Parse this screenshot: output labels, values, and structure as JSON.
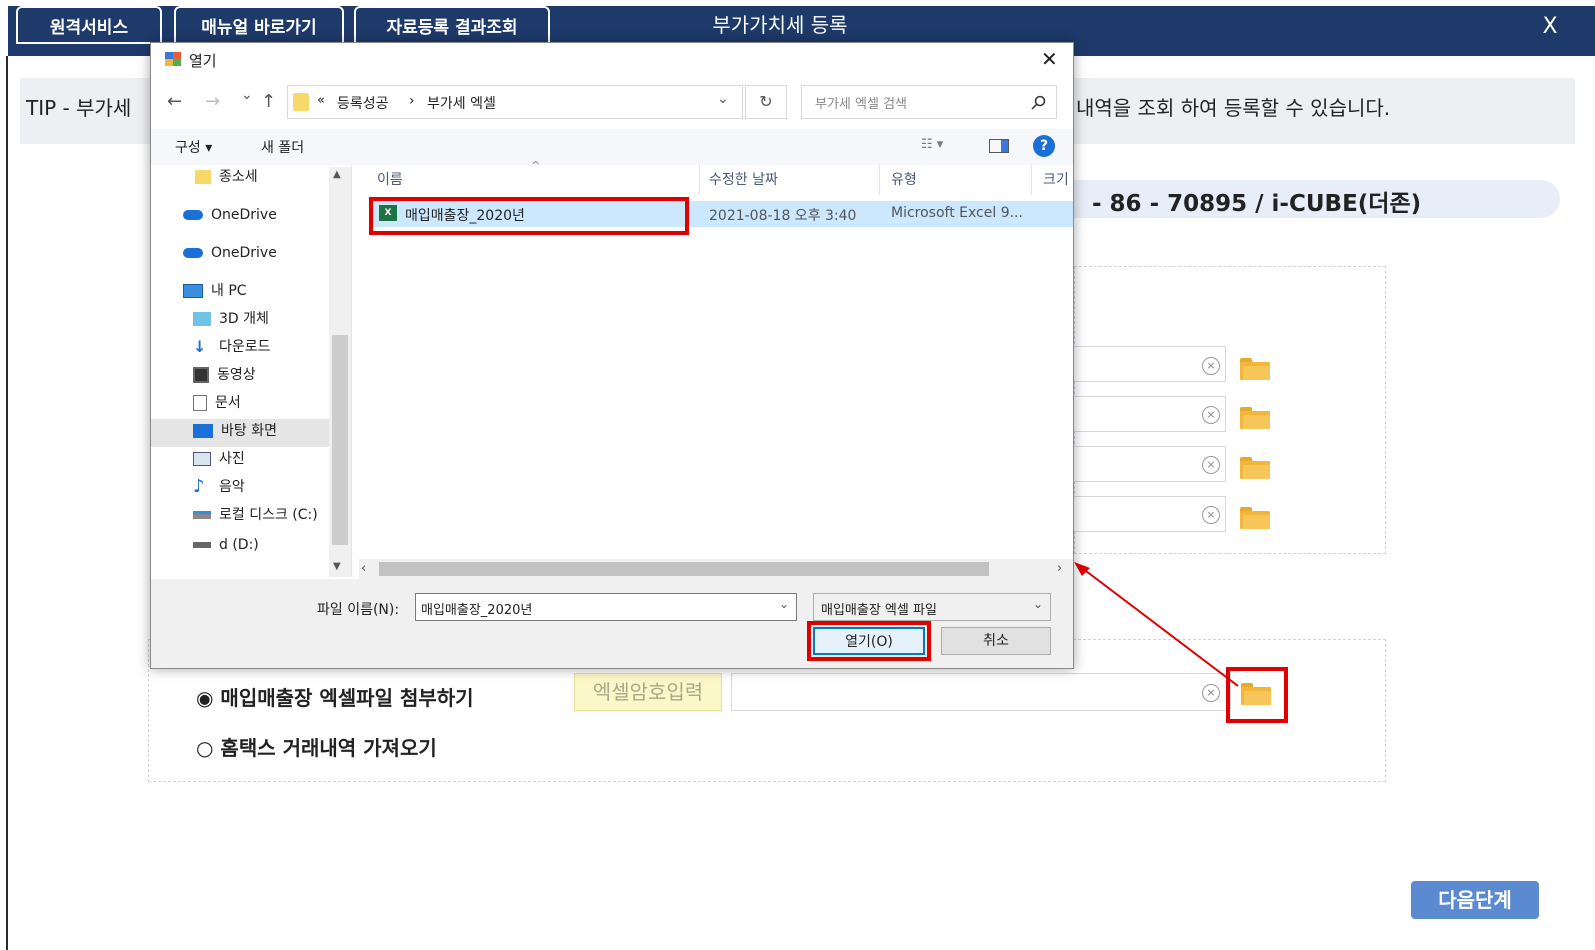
{
  "topbar": {
    "btn_remote": "원격서비스",
    "btn_manual": "매뉴얼 바로가기",
    "btn_results": "자료등록 결과조회",
    "title": "부가가치세 등록",
    "close": "X"
  },
  "tip": {
    "left": "TIP - 부가세",
    "right": "내역을 조회 하여 등록할 수 있습니다."
  },
  "business": {
    "text": "- 86 - 70895 / i-CUBE(더존)"
  },
  "options": {
    "radio_attach": "◉ 매입매출장 엑셀파일 첨부하기",
    "radio_hometax": "○ 홈택스 거래내역 가져오기",
    "password_placeholder": "엑셀암호입력",
    "clear": "×"
  },
  "next_button": "다음단계",
  "dialog": {
    "title": "열기",
    "close": "✕",
    "nav_back": "←",
    "nav_forward": "→",
    "nav_dropdown": "⌄",
    "nav_up": "↑",
    "breadcrumb_prefix": "«",
    "breadcrumb_1": "등록성공",
    "breadcrumb_sep": "›",
    "breadcrumb_2": "부가세 엑셀",
    "refresh": "↻",
    "search_placeholder": "부가세 엑셀 검색",
    "organize": "구성 ▾",
    "new_folder": "새 폴더",
    "help": "?",
    "nav_items": [
      "종소세",
      "OneDrive",
      "OneDrive",
      "내 PC",
      "3D 개체",
      "다운로드",
      "동영상",
      "문서",
      "바탕 화면",
      "사진",
      "음악",
      "로컬 디스크 (C:)",
      "d (D:)"
    ],
    "columns": {
      "name": "이름",
      "modified": "수정한 날짜",
      "type": "유형",
      "size": "크기"
    },
    "file": {
      "name": "매입매출장_2020년",
      "modified": "2021-08-18 오후 3:40",
      "type": "Microsoft Excel 9..."
    },
    "filename_label": "파일 이름(N):",
    "filename_value": "매입매출장_2020년",
    "filetype_value": "매입매출장 엑셀 파일",
    "open_button": "열기(O)",
    "cancel_button": "취소"
  },
  "colors": {
    "topbar": "#1e3a6b",
    "highlight": "#e00000",
    "selection": "#cce8ff",
    "next_button": "#5b8ad1"
  }
}
